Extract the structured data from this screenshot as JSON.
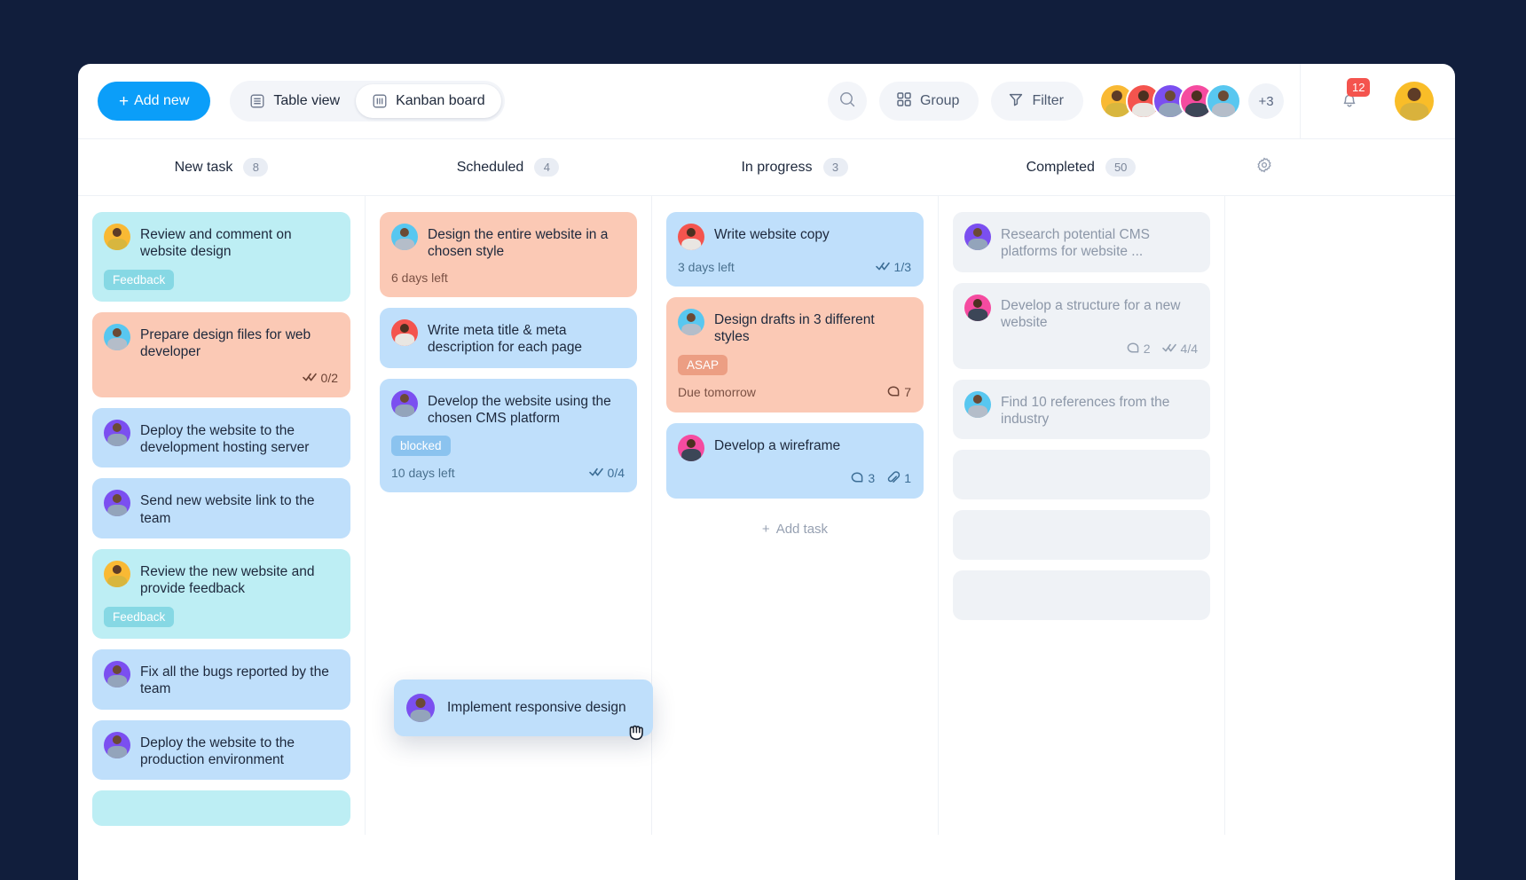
{
  "toolbar": {
    "add_new_label": "Add new",
    "table_view_label": "Table view",
    "kanban_view_label": "Kanban board",
    "group_label": "Group",
    "filter_label": "Filter",
    "overflow_avatars_label": "+3",
    "notification_count": "12",
    "icons": {
      "search": "search-icon",
      "group": "grid-icon",
      "filter": "funnel-icon",
      "bell": "bell-icon",
      "settings": "gear-icon"
    },
    "avatar_colors": [
      "#f9b934",
      "#f4544e",
      "#7b4ff0",
      "#f54ba0",
      "#58c7f0"
    ],
    "me_avatar_color": "#f9bd28"
  },
  "accent_color": "#0b9ef9",
  "app_background": "#111e3c",
  "columns": [
    {
      "title": "New task",
      "count": "8",
      "cards": [
        {
          "title": "Review and comment on website design",
          "color": "cyan",
          "avatar_color": "#f9b934",
          "tag": "Feedback",
          "tag_style": "feedback",
          "due": "",
          "checklist": "",
          "comments": "",
          "attachments": ""
        },
        {
          "title": "Prepare design files for web developer",
          "color": "peach",
          "avatar_color": "#58c7f0",
          "tag": "",
          "tag_style": "",
          "due": "",
          "checklist": "0/2",
          "comments": "",
          "attachments": ""
        },
        {
          "title": "Deploy the website to the development hosting server",
          "color": "blue",
          "avatar_color": "#7b4ff0",
          "tag": "",
          "tag_style": "",
          "due": "",
          "checklist": "",
          "comments": "",
          "attachments": ""
        },
        {
          "title": "Send new website link to the team",
          "color": "blue",
          "avatar_color": "#7b4ff0",
          "tag": "",
          "tag_style": "",
          "due": "",
          "checklist": "",
          "comments": "",
          "attachments": ""
        },
        {
          "title": "Review the new website and provide feedback",
          "color": "cyan",
          "avatar_color": "#f9b934",
          "tag": "Feedback",
          "tag_style": "feedback",
          "due": "",
          "checklist": "",
          "comments": "",
          "attachments": ""
        },
        {
          "title": "Fix all the bugs reported by the team",
          "color": "blue",
          "avatar_color": "#7b4ff0",
          "tag": "",
          "tag_style": "",
          "due": "",
          "checklist": "",
          "comments": "",
          "attachments": ""
        },
        {
          "title": "Deploy the website to the production environment",
          "color": "blue",
          "avatar_color": "#7b4ff0",
          "tag": "",
          "tag_style": "",
          "due": "",
          "checklist": "",
          "comments": "",
          "attachments": ""
        },
        {
          "title": "",
          "color": "cyan",
          "avatar_color": "#f9b934",
          "tag": "",
          "tag_style": "",
          "due": "",
          "checklist": "",
          "comments": "",
          "attachments": ""
        }
      ]
    },
    {
      "title": "Scheduled",
      "count": "4",
      "cards": [
        {
          "title": "Design the entire website in a chosen style",
          "color": "peach",
          "avatar_color": "#58c7f0",
          "tag": "",
          "tag_style": "",
          "due": "6 days left",
          "checklist": "",
          "comments": "",
          "attachments": ""
        },
        {
          "title": "Write meta title & meta description for each page",
          "color": "blue",
          "avatar_color": "#f4544e",
          "tag": "",
          "tag_style": "",
          "due": "",
          "checklist": "",
          "comments": "",
          "attachments": ""
        },
        {
          "title": "Develop the website using the chosen CMS platform",
          "color": "blue",
          "avatar_color": "#7b4ff0",
          "tag": "blocked",
          "tag_style": "blocked",
          "due": "10 days left",
          "checklist": "0/4",
          "comments": "",
          "attachments": ""
        }
      ]
    },
    {
      "title": "In progress",
      "count": "3",
      "add_task_label": "Add task",
      "cards": [
        {
          "title": "Write website copy",
          "color": "blue",
          "avatar_color": "#f4544e",
          "tag": "",
          "tag_style": "",
          "due": "3 days left",
          "checklist": "1/3",
          "comments": "",
          "attachments": ""
        },
        {
          "title": "Design drafts in 3 different styles",
          "color": "peach",
          "avatar_color": "#58c7f0",
          "tag": "ASAP",
          "tag_style": "asap",
          "due": "Due tomorrow",
          "checklist": "",
          "comments": "7",
          "attachments": ""
        },
        {
          "title": "Develop a wireframe",
          "color": "blue",
          "avatar_color": "#f54ba0",
          "tag": "",
          "tag_style": "",
          "due": "",
          "checklist": "",
          "comments": "3",
          "attachments": "1"
        }
      ]
    },
    {
      "title": "Completed",
      "count": "50",
      "cards": [
        {
          "title": "Research potential CMS platforms for website ...",
          "color": "grey",
          "avatar_color": "#7b4ff0",
          "tag": "",
          "tag_style": "",
          "due": "",
          "checklist": "",
          "comments": "",
          "attachments": ""
        },
        {
          "title": "Develop a structure for a new website",
          "color": "grey",
          "avatar_color": "#f54ba0",
          "tag": "",
          "tag_style": "",
          "due": "",
          "checklist": "4/4",
          "comments": "2",
          "attachments": ""
        },
        {
          "title": "Find 10 references from the industry",
          "color": "grey",
          "avatar_color": "#58c7f0",
          "tag": "",
          "tag_style": "",
          "due": "",
          "checklist": "",
          "comments": "",
          "attachments": ""
        }
      ],
      "placeholder_count": 3
    }
  ],
  "dragging_card": {
    "title": "Implement responsive design",
    "avatar_color": "#7b4ff0",
    "cursor": "grabbing-hand-cursor"
  }
}
